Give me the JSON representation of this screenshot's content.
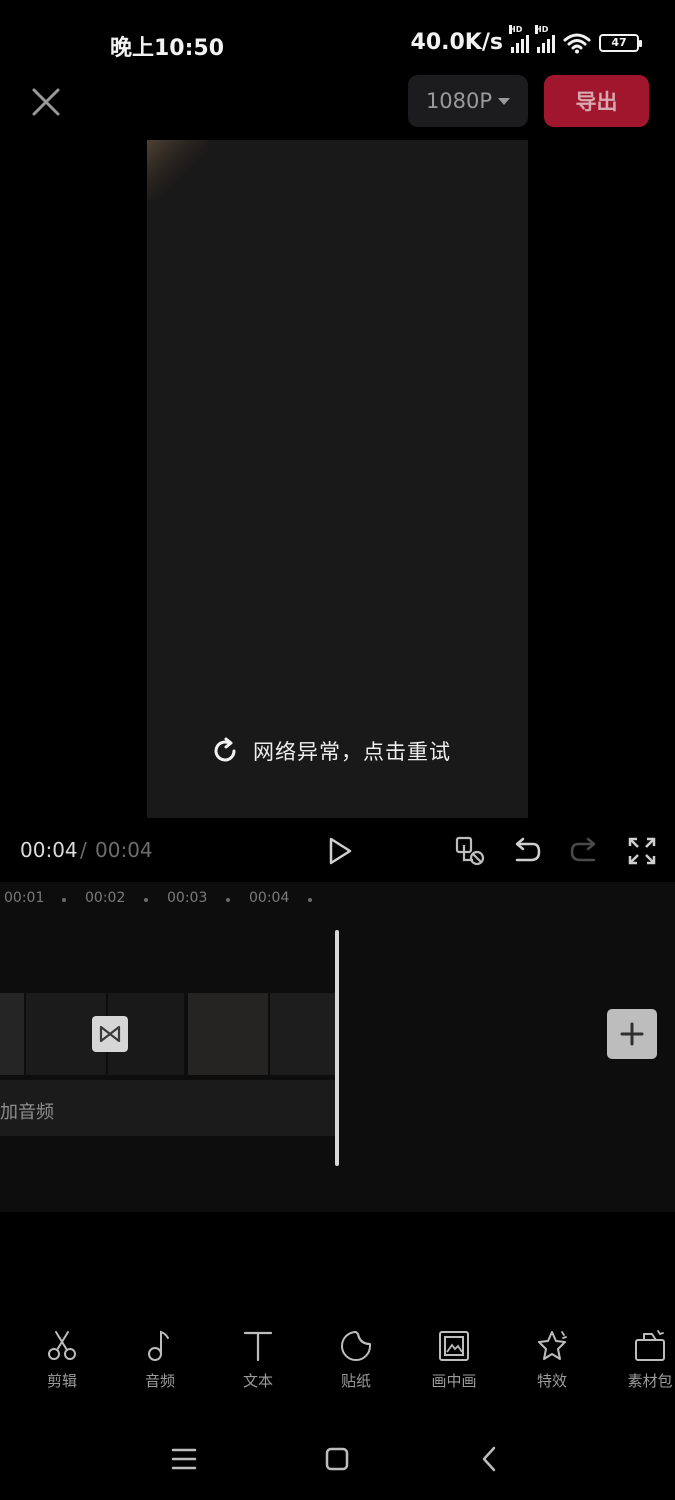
{
  "status_bar": {
    "time": "晚上10:50",
    "net_speed": "40.0K/s",
    "signal_badge": "HD",
    "battery": "47"
  },
  "top_bar": {
    "close_icon": "close-icon",
    "resolution": "1080P",
    "export_label": "导出",
    "accent_color": "#a0172d"
  },
  "preview": {
    "error_message": "网络异常，点击重试",
    "retry_icon": "refresh-icon"
  },
  "playback": {
    "current_time": "00:04",
    "separator": "/",
    "total_time": "00:04"
  },
  "timeline": {
    "ruler_ticks": [
      "00:01",
      "00:02",
      "00:03",
      "00:04"
    ],
    "audio_track_label": "加音频"
  },
  "toolbar": {
    "items": [
      {
        "label": "剪辑",
        "icon": "scissors-icon"
      },
      {
        "label": "音频",
        "icon": "music-note-icon"
      },
      {
        "label": "文本",
        "icon": "text-icon"
      },
      {
        "label": "贴纸",
        "icon": "sticker-icon"
      },
      {
        "label": "画中画",
        "icon": "picture-in-picture-icon"
      },
      {
        "label": "特效",
        "icon": "star-effect-icon"
      },
      {
        "label": "素材包",
        "icon": "material-pack-icon"
      }
    ]
  }
}
